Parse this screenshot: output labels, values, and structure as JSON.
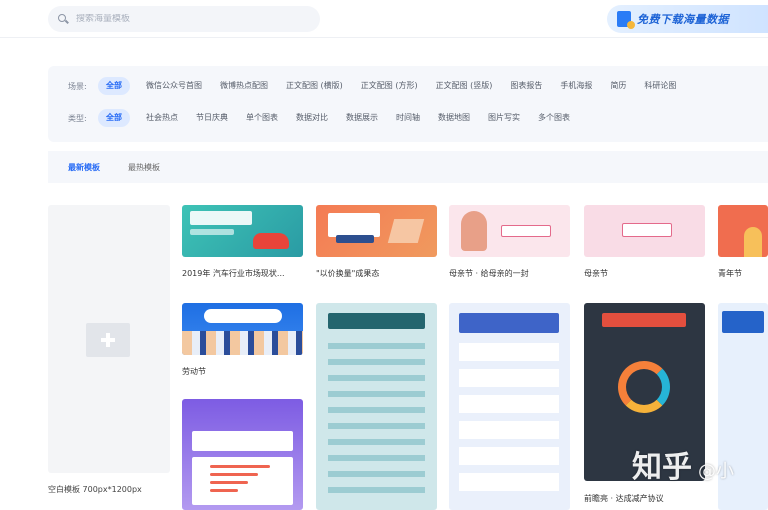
{
  "header": {
    "search_placeholder": "搜索海量模板",
    "promo_label": "免费下载海量数据"
  },
  "filters": {
    "row1_label": "场景:",
    "row1_chips": [
      "全部",
      "微信公众号首图",
      "微博热点配图",
      "正文配图 (横版)",
      "正文配图 (方形)",
      "正文配图 (竖版)",
      "图表报告",
      "手机海报",
      "简历",
      "科研论图"
    ],
    "row2_label": "类型:",
    "row2_chips": [
      "全部",
      "社会热点",
      "节日庆典",
      "单个图表",
      "数据对比",
      "数据展示",
      "时间轴",
      "数据地图",
      "图片写实",
      "多个图表"
    ]
  },
  "tabs": [
    "最新模板",
    "最热模板"
  ],
  "blank_card_label": "空白模板 700px*1200px",
  "cards": [
    {
      "caption": "2019年 汽车行业市场现状..."
    },
    {
      "caption": "\"以价换量\"成果态"
    },
    {
      "caption": "母亲节 · 给母亲的一封"
    },
    {
      "caption": "母亲节"
    },
    {
      "caption": "青年节"
    },
    {
      "caption": "劳动节"
    },
    {
      "caption": "前瞻亮 · 达成减产协议"
    }
  ],
  "watermark": {
    "main": "知乎",
    "sub": "@小"
  },
  "colors": {
    "accent": "#2a6df5",
    "panel_bg": "#f5f7fb"
  }
}
